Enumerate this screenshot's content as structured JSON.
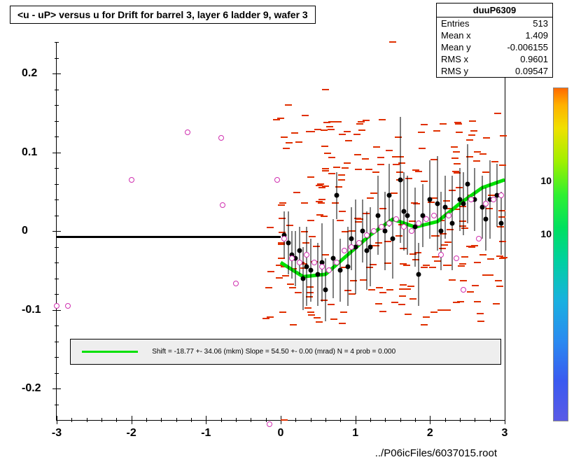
{
  "title": "<u - uP>      versus   u for Drift for barrel 3, layer 6 ladder 9, wafer 3",
  "stats": {
    "name": "duuP6309",
    "rows": [
      {
        "label": "Entries",
        "value": "513"
      },
      {
        "label": "Mean x",
        "value": "1.409"
      },
      {
        "label": "Mean y",
        "value": "-0.006155"
      },
      {
        "label": "RMS x",
        "value": "0.9601"
      },
      {
        "label": "RMS y",
        "value": "0.09547"
      }
    ]
  },
  "legend": "Shift =   -18.77 +- 34.06 (mkm) Slope =    54.50 +- 0.00 (mrad)  N = 4 prob = 0.000",
  "caption": "../P06icFiles/6037015.root",
  "colorbar_labels": [
    {
      "text": "10",
      "pos": 0.56
    },
    {
      "text": "10",
      "pos": 0.72
    }
  ],
  "chart_data": {
    "type": "scatter",
    "xlabel": "",
    "ylabel": "",
    "xlim": [
      -3,
      3
    ],
    "ylim": [
      -0.24,
      0.24
    ],
    "x_ticks": [
      -3,
      -2,
      -1,
      0,
      1,
      2,
      3
    ],
    "y_ticks": [
      -0.2,
      -0.1,
      0,
      0.1,
      0.2
    ],
    "black_line": {
      "x": [
        -3,
        0
      ],
      "y": -0.007
    },
    "fit_curve": [
      {
        "x": 0.0,
        "y": -0.04
      },
      {
        "x": 0.3,
        "y": -0.058
      },
      {
        "x": 0.6,
        "y": -0.055
      },
      {
        "x": 0.9,
        "y": -0.03
      },
      {
        "x": 1.2,
        "y": -0.005
      },
      {
        "x": 1.5,
        "y": 0.015
      },
      {
        "x": 1.8,
        "y": 0.005
      },
      {
        "x": 2.1,
        "y": 0.012
      },
      {
        "x": 2.4,
        "y": 0.035
      },
      {
        "x": 2.7,
        "y": 0.055
      },
      {
        "x": 3.0,
        "y": 0.065
      }
    ],
    "legend_box_y": -0.155,
    "series": [
      {
        "name": "black-points",
        "style": "black-dot",
        "err": true,
        "points": [
          {
            "x": 0.05,
            "y": -0.005,
            "e": 0.03
          },
          {
            "x": 0.1,
            "y": -0.015,
            "e": 0.04
          },
          {
            "x": 0.15,
            "y": -0.03,
            "e": 0.03
          },
          {
            "x": 0.2,
            "y": -0.035,
            "e": 0.035
          },
          {
            "x": 0.25,
            "y": -0.025,
            "e": 0.03
          },
          {
            "x": 0.3,
            "y": -0.06,
            "e": 0.04
          },
          {
            "x": 0.35,
            "y": -0.045,
            "e": 0.05
          },
          {
            "x": 0.4,
            "y": -0.05,
            "e": 0.04
          },
          {
            "x": 0.5,
            "y": -0.055,
            "e": 0.04
          },
          {
            "x": 0.55,
            "y": -0.04,
            "e": 0.05
          },
          {
            "x": 0.6,
            "y": -0.075,
            "e": 0.04
          },
          {
            "x": 0.7,
            "y": -0.035,
            "e": 0.05
          },
          {
            "x": 0.75,
            "y": 0.045,
            "e": 0.03
          },
          {
            "x": 0.8,
            "y": -0.05,
            "e": 0.04
          },
          {
            "x": 0.9,
            "y": -0.045,
            "e": 0.05
          },
          {
            "x": 0.95,
            "y": -0.01,
            "e": 0.04
          },
          {
            "x": 1.0,
            "y": -0.02,
            "e": 0.06
          },
          {
            "x": 1.1,
            "y": 0.0,
            "e": 0.04
          },
          {
            "x": 1.15,
            "y": -0.025,
            "e": 0.05
          },
          {
            "x": 1.2,
            "y": -0.02,
            "e": 0.05
          },
          {
            "x": 1.3,
            "y": 0.02,
            "e": 0.05
          },
          {
            "x": 1.4,
            "y": 0.0,
            "e": 0.05
          },
          {
            "x": 1.45,
            "y": 0.045,
            "e": 0.04
          },
          {
            "x": 1.5,
            "y": -0.01,
            "e": 0.05
          },
          {
            "x": 1.6,
            "y": 0.065,
            "e": 0.08
          },
          {
            "x": 1.65,
            "y": 0.025,
            "e": 0.05
          },
          {
            "x": 1.7,
            "y": 0.02,
            "e": 0.05
          },
          {
            "x": 1.8,
            "y": 0.005,
            "e": 0.05
          },
          {
            "x": 1.85,
            "y": -0.055,
            "e": 0.04
          },
          {
            "x": 1.9,
            "y": 0.02,
            "e": 0.04
          },
          {
            "x": 2.0,
            "y": 0.04,
            "e": 0.05
          },
          {
            "x": 2.1,
            "y": 0.035,
            "e": 0.06
          },
          {
            "x": 2.15,
            "y": 0.0,
            "e": 0.05
          },
          {
            "x": 2.2,
            "y": 0.03,
            "e": 0.04
          },
          {
            "x": 2.3,
            "y": 0.01,
            "e": 0.06
          },
          {
            "x": 2.4,
            "y": 0.04,
            "e": 0.04
          },
          {
            "x": 2.45,
            "y": 0.035,
            "e": 0.04
          },
          {
            "x": 2.5,
            "y": 0.06,
            "e": 0.05
          },
          {
            "x": 2.6,
            "y": 0.04,
            "e": 0.04
          },
          {
            "x": 2.7,
            "y": 0.03,
            "e": 0.04
          },
          {
            "x": 2.75,
            "y": 0.015,
            "e": 0.04
          },
          {
            "x": 2.8,
            "y": 0.04,
            "e": 0.05
          },
          {
            "x": 2.9,
            "y": 0.045,
            "e": 0.04
          },
          {
            "x": 2.95,
            "y": 0.01,
            "e": 0.04
          }
        ]
      },
      {
        "name": "pink-points",
        "style": "pink-circ",
        "err": false,
        "points": [
          {
            "x": -3.0,
            "y": -0.095
          },
          {
            "x": -2.85,
            "y": -0.095
          },
          {
            "x": -2.0,
            "y": 0.065
          },
          {
            "x": -1.25,
            "y": 0.125
          },
          {
            "x": -0.8,
            "y": 0.118
          },
          {
            "x": -0.78,
            "y": 0.033
          },
          {
            "x": -0.6,
            "y": -0.067
          },
          {
            "x": -0.15,
            "y": -0.245
          },
          {
            "x": -0.05,
            "y": 0.065
          },
          {
            "x": 0.05,
            "y": -0.01
          },
          {
            "x": 0.15,
            "y": -0.035
          },
          {
            "x": 0.25,
            "y": -0.04
          },
          {
            "x": 0.35,
            "y": -0.03
          },
          {
            "x": 0.45,
            "y": -0.04
          },
          {
            "x": 0.55,
            "y": -0.045
          },
          {
            "x": 0.65,
            "y": -0.05
          },
          {
            "x": 0.75,
            "y": -0.04
          },
          {
            "x": 0.85,
            "y": -0.025
          },
          {
            "x": 0.95,
            "y": -0.02
          },
          {
            "x": 1.05,
            "y": -0.015
          },
          {
            "x": 1.15,
            "y": -0.005
          },
          {
            "x": 1.25,
            "y": 0.0
          },
          {
            "x": 1.35,
            "y": 0.005
          },
          {
            "x": 1.45,
            "y": 0.01
          },
          {
            "x": 1.55,
            "y": 0.015
          },
          {
            "x": 1.65,
            "y": 0.005
          },
          {
            "x": 1.75,
            "y": 0.0
          },
          {
            "x": 1.85,
            "y": 0.01
          },
          {
            "x": 1.95,
            "y": 0.015
          },
          {
            "x": 2.05,
            "y": 0.02
          },
          {
            "x": 2.15,
            "y": -0.03
          },
          {
            "x": 2.25,
            "y": 0.02
          },
          {
            "x": 2.35,
            "y": -0.035
          },
          {
            "x": 2.45,
            "y": -0.075
          },
          {
            "x": 2.55,
            "y": 0.04
          },
          {
            "x": 2.65,
            "y": -0.01
          },
          {
            "x": 2.75,
            "y": 0.035
          },
          {
            "x": 2.85,
            "y": 0.04
          },
          {
            "x": 2.95,
            "y": 0.045
          }
        ]
      },
      {
        "name": "red-scatter",
        "style": "red-dash",
        "err": false,
        "random": {
          "count": 260,
          "xrange": [
            -0.2,
            3.0
          ],
          "yrange": [
            -0.12,
            0.15
          ],
          "outliers": [
            {
              "x": 1.5,
              "y": 0.24
            },
            {
              "x": 2.9,
              "y": 0.24
            },
            {
              "x": 0.1,
              "y": 0.16
            },
            {
              "x": 0.05,
              "y": -0.24
            },
            {
              "x": 2.15,
              "y": -0.1
            },
            {
              "x": 0.6,
              "y": 0.18
            }
          ]
        }
      }
    ]
  }
}
